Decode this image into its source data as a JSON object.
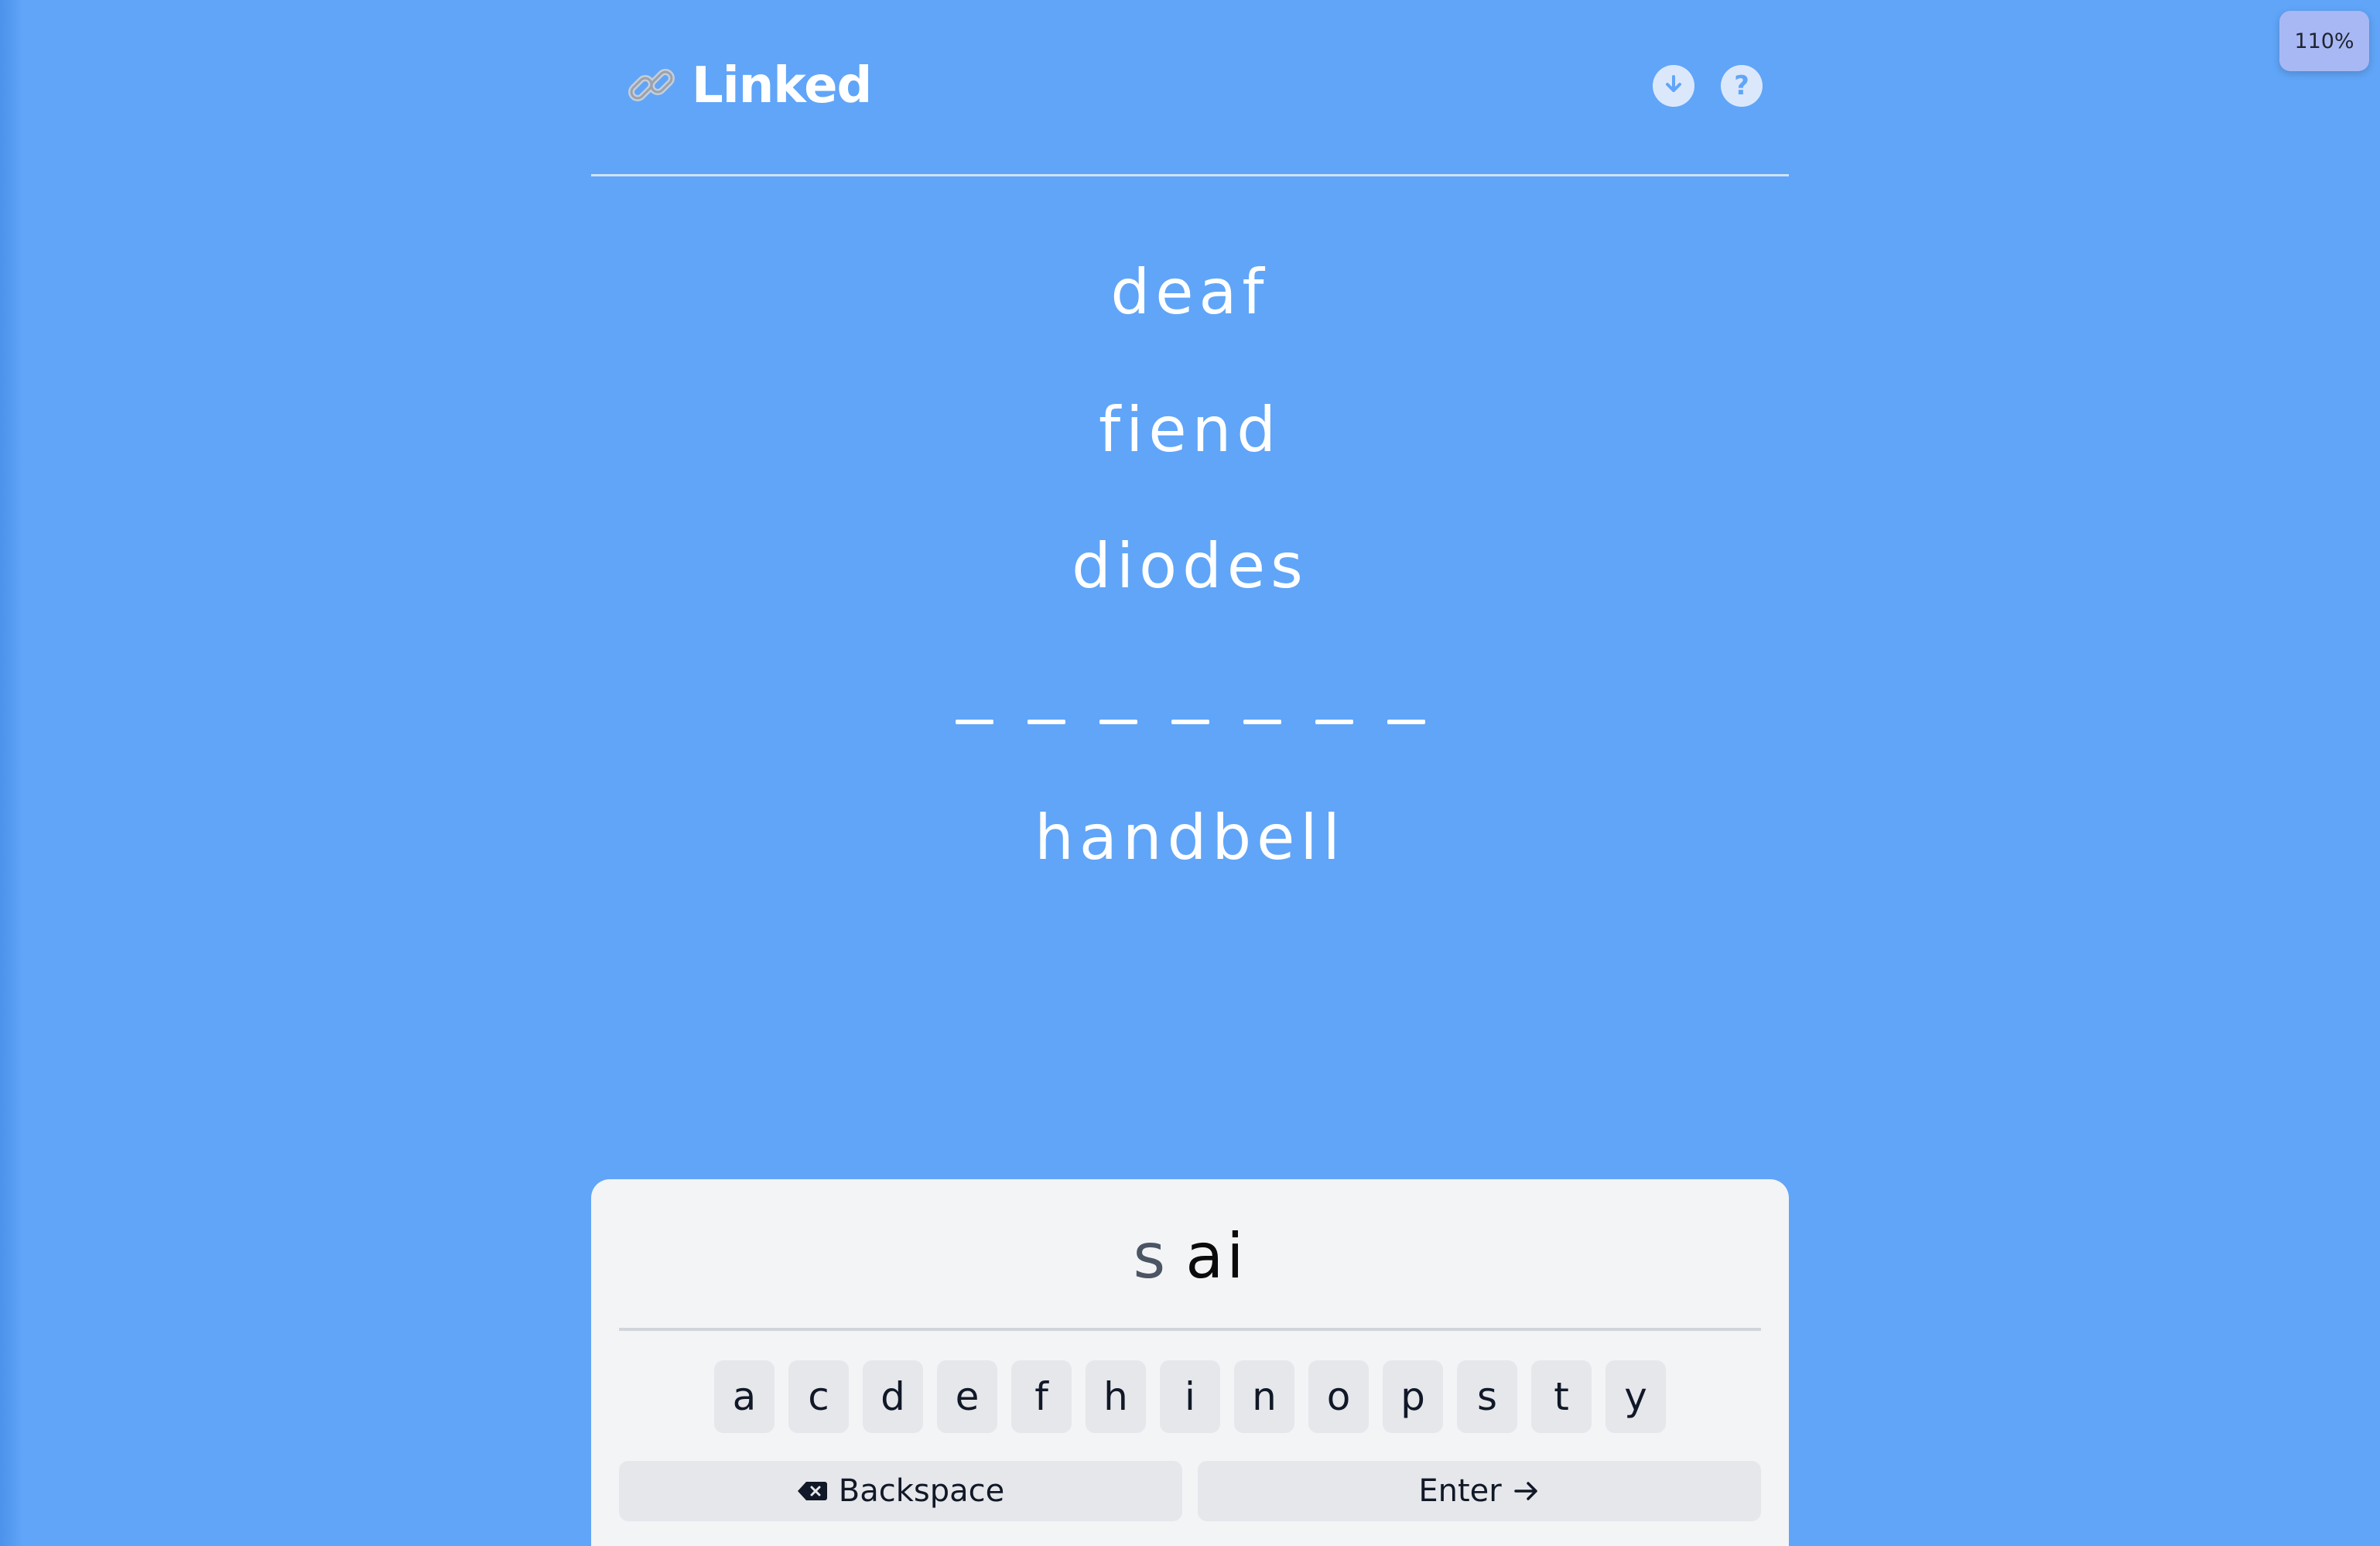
{
  "zoom": "110%",
  "header": {
    "title": "Linked",
    "icons": [
      "link-icon",
      "download-icon",
      "help-icon"
    ],
    "help_label": "?"
  },
  "puzzle": {
    "words": [
      "deaf",
      "fiend",
      "diodes"
    ],
    "blank_count": 7,
    "last_word": "handbell"
  },
  "input": {
    "hint": "s",
    "typed": "ai"
  },
  "keyboard": {
    "keys": [
      "a",
      "c",
      "d",
      "e",
      "f",
      "h",
      "i",
      "n",
      "o",
      "p",
      "s",
      "t",
      "y"
    ],
    "backspace_label": "Backspace",
    "enter_label": "Enter"
  },
  "colors": {
    "background": "#60a5f8",
    "panel": "#f3f4f6",
    "key": "#e5e7eb"
  }
}
